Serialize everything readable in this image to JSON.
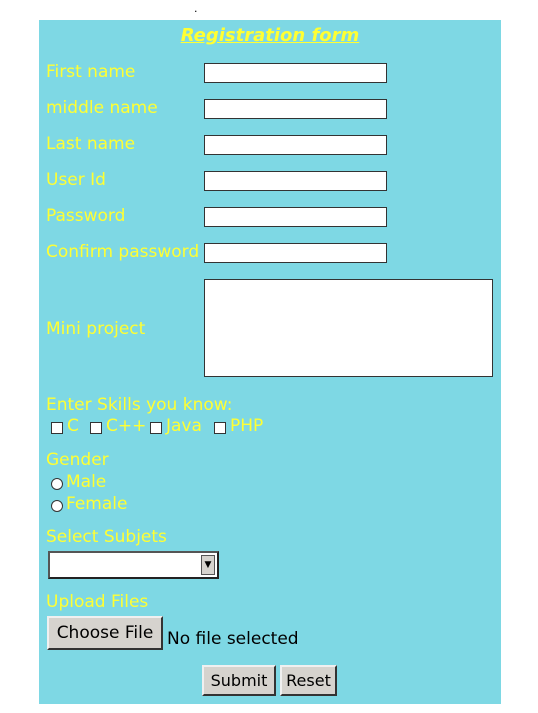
{
  "top_dot": ".",
  "form": {
    "title": "Registration form",
    "fields": [
      {
        "label": "First name",
        "value": ""
      },
      {
        "label": "middle name",
        "value": ""
      },
      {
        "label": "Last name",
        "value": ""
      },
      {
        "label": "User Id",
        "value": ""
      },
      {
        "label": "Password",
        "value": ""
      },
      {
        "label": "Confirm password",
        "value": ""
      }
    ],
    "mini_project": {
      "label": "Mini project",
      "value": ""
    },
    "skills": {
      "heading": "Enter Skills you know:",
      "options": [
        {
          "label": "C",
          "checked": false
        },
        {
          "label": "C++",
          "checked": false
        },
        {
          "label": "Java",
          "checked": false
        },
        {
          "label": "PHP",
          "checked": false
        }
      ]
    },
    "gender": {
      "heading": "Gender",
      "options": [
        {
          "label": "Male",
          "selected": false
        },
        {
          "label": "Female",
          "selected": false
        }
      ]
    },
    "subjects": {
      "heading": "Select Subjets",
      "selected": ""
    },
    "upload": {
      "heading": "Upload Files",
      "button_label": "Choose File",
      "status": "No file selected"
    },
    "actions": {
      "submit_label": "Submit",
      "reset_label": "Reset"
    }
  },
  "colors": {
    "panel_bg": "#7ed8e4",
    "label_text": "#ffff33"
  }
}
